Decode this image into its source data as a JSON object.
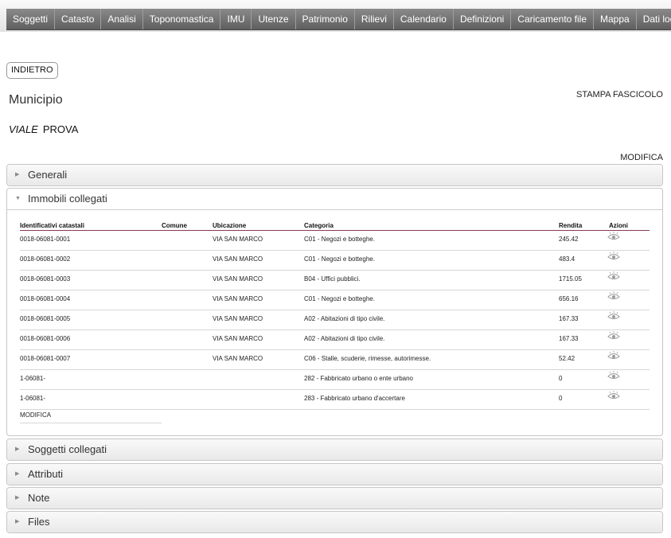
{
  "nav": [
    "Soggetti",
    "Catasto",
    "Analisi",
    "Toponomastica",
    "IMU",
    "Utenze",
    "Patrimonio",
    "Rilievi",
    "Calendario",
    "Definizioni",
    "Caricamento file",
    "Mappa",
    "Dati login"
  ],
  "back_label": "INDIETRO",
  "page_title": "Municipio",
  "print_label": "STAMPA FASCICOLO",
  "address": {
    "type": "VIALE",
    "name": "PROVA"
  },
  "edit_label": "MODIFICA",
  "sections": {
    "generali": "Generali",
    "immobili": "Immobili collegati",
    "soggetti": "Soggetti collegati",
    "attributi": "Attributi",
    "note": "Note",
    "files": "Files"
  },
  "table": {
    "headers": [
      "Identificativi catastali",
      "Comune",
      "Ubicazione",
      "Categoria",
      "Rendita",
      "Azioni"
    ],
    "rows": [
      [
        "0018-06081-0001",
        "",
        "VIA SAN MARCO",
        "C01 - Negozi e botteghe.",
        "245.42"
      ],
      [
        "0018-06081-0002",
        "",
        "VIA SAN MARCO",
        "C01 - Negozi e botteghe.",
        "483.4"
      ],
      [
        "0018-06081-0003",
        "",
        "VIA SAN MARCO",
        "B04 - Uffici pubblici.",
        "1715.05"
      ],
      [
        "0018-06081-0004",
        "",
        "VIA SAN MARCO",
        "C01 - Negozi e botteghe.",
        "656.16"
      ],
      [
        "0018-06081-0005",
        "",
        "VIA SAN MARCO",
        "A02 - Abitazioni di tipo civile.",
        "167.33"
      ],
      [
        "0018-06081-0006",
        "",
        "VIA SAN MARCO",
        "A02 - Abitazioni di tipo civile.",
        "167.33"
      ],
      [
        "0018-06081-0007",
        "",
        "VIA SAN MARCO",
        "C06 - Stalle, scuderie, rimesse, autorimesse.",
        "52.42"
      ],
      [
        "1-06081-",
        "",
        "",
        "282 - Fabbricato urbano o ente urbano",
        "0"
      ],
      [
        "1-06081-",
        "",
        "",
        "283 - Fabbricato urbano d'accertare",
        "0"
      ]
    ],
    "action_icon": "eye-icon",
    "edit_label": "MODIFICA"
  }
}
